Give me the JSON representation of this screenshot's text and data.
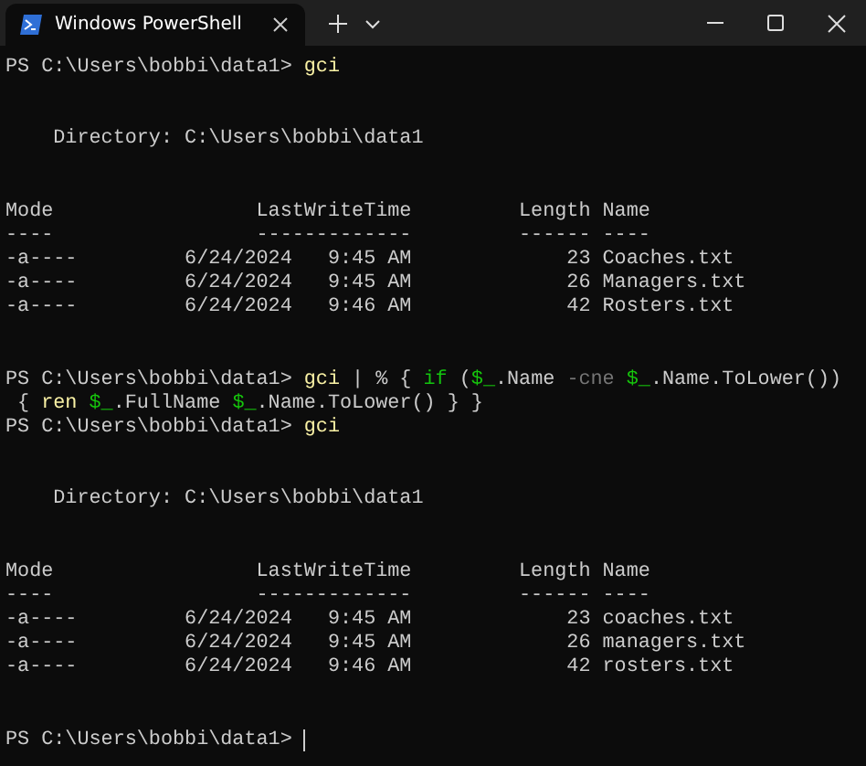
{
  "tab": {
    "title": "Windows PowerShell",
    "selected": true
  },
  "terminal": {
    "cursor_visible": true,
    "lines": [
      {
        "kind": "text",
        "segments": [
          {
            "kind": "prompt",
            "text": "PS C:\\Users\\bobbi\\data1> "
          },
          {
            "kind": "command",
            "text": "gci"
          }
        ]
      },
      {
        "kind": "blank"
      },
      {
        "kind": "blank"
      },
      {
        "kind": "text",
        "segments": [
          {
            "kind": "output",
            "text": "    Directory: C:\\Users\\bobbi\\data1"
          }
        ]
      },
      {
        "kind": "blank"
      },
      {
        "kind": "blank"
      },
      {
        "kind": "text",
        "segments": [
          {
            "kind": "output",
            "text": "Mode                 LastWriteTime         Length Name"
          }
        ]
      },
      {
        "kind": "text",
        "segments": [
          {
            "kind": "output",
            "text": "----                 -------------         ------ ----"
          }
        ]
      },
      {
        "kind": "text",
        "segments": [
          {
            "kind": "output",
            "text": "-a----         6/24/2024   9:45 AM             23 Coaches.txt"
          }
        ]
      },
      {
        "kind": "text",
        "segments": [
          {
            "kind": "output",
            "text": "-a----         6/24/2024   9:45 AM             26 Managers.txt"
          }
        ]
      },
      {
        "kind": "text",
        "segments": [
          {
            "kind": "output",
            "text": "-a----         6/24/2024   9:46 AM             42 Rosters.txt"
          }
        ]
      },
      {
        "kind": "blank"
      },
      {
        "kind": "blank"
      },
      {
        "kind": "text",
        "segments": [
          {
            "kind": "prompt",
            "text": "PS C:\\Users\\bobbi\\data1> "
          },
          {
            "kind": "command",
            "text": "gci"
          },
          {
            "kind": "plain",
            "text": " | % { "
          },
          {
            "kind": "keyword",
            "text": "if"
          },
          {
            "kind": "plain",
            "text": " ("
          },
          {
            "kind": "variable",
            "text": "$_"
          },
          {
            "kind": "plain",
            "text": ".Name "
          },
          {
            "kind": "operator",
            "text": "-cne"
          },
          {
            "kind": "variable",
            "text": " $_"
          },
          {
            "kind": "plain",
            "text": ".Name.ToLower())"
          }
        ]
      },
      {
        "kind": "text",
        "segments": [
          {
            "kind": "plain",
            "text": " { "
          },
          {
            "kind": "command",
            "text": "ren"
          },
          {
            "kind": "variable",
            "text": " $_"
          },
          {
            "kind": "plain",
            "text": ".FullName "
          },
          {
            "kind": "variable",
            "text": "$_"
          },
          {
            "kind": "plain",
            "text": ".Name.ToLower() } }"
          }
        ]
      },
      {
        "kind": "text",
        "segments": [
          {
            "kind": "prompt",
            "text": "PS C:\\Users\\bobbi\\data1> "
          },
          {
            "kind": "command",
            "text": "gci"
          }
        ]
      },
      {
        "kind": "blank"
      },
      {
        "kind": "blank"
      },
      {
        "kind": "text",
        "segments": [
          {
            "kind": "output",
            "text": "    Directory: C:\\Users\\bobbi\\data1"
          }
        ]
      },
      {
        "kind": "blank"
      },
      {
        "kind": "blank"
      },
      {
        "kind": "text",
        "segments": [
          {
            "kind": "output",
            "text": "Mode                 LastWriteTime         Length Name"
          }
        ]
      },
      {
        "kind": "text",
        "segments": [
          {
            "kind": "output",
            "text": "----                 -------------         ------ ----"
          }
        ]
      },
      {
        "kind": "text",
        "segments": [
          {
            "kind": "output",
            "text": "-a----         6/24/2024   9:45 AM             23 coaches.txt"
          }
        ]
      },
      {
        "kind": "text",
        "segments": [
          {
            "kind": "output",
            "text": "-a----         6/24/2024   9:45 AM             26 managers.txt"
          }
        ]
      },
      {
        "kind": "text",
        "segments": [
          {
            "kind": "output",
            "text": "-a----         6/24/2024   9:46 AM             42 rosters.txt"
          }
        ]
      },
      {
        "kind": "blank"
      },
      {
        "kind": "blank"
      },
      {
        "kind": "text",
        "segments": [
          {
            "kind": "prompt",
            "text": "PS C:\\Users\\bobbi\\data1> "
          }
        ]
      }
    ]
  }
}
